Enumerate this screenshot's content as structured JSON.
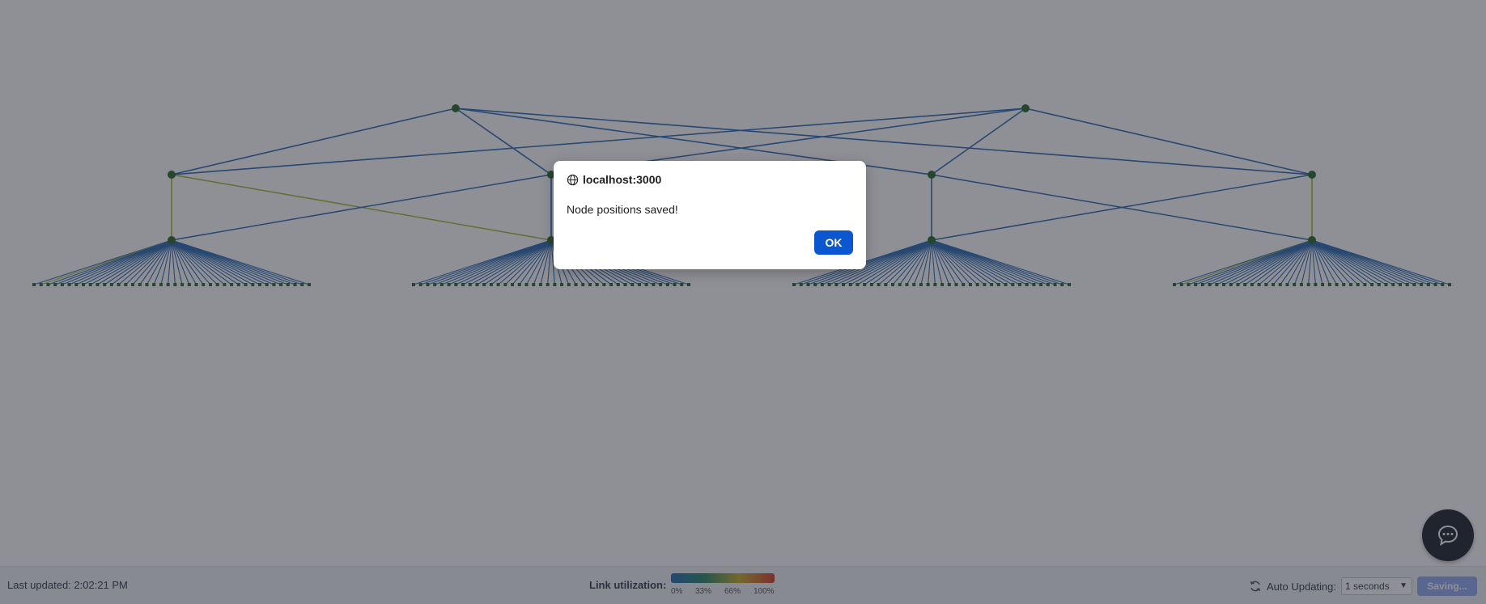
{
  "footer": {
    "last_updated": "Last updated: 2:02:21 PM",
    "legend": {
      "label": "Link utilization:",
      "ticks": [
        "0%",
        "33%",
        "66%",
        "100%"
      ],
      "colors": [
        "#2a6eb8",
        "#2e8a6a",
        "#c8b12f",
        "#d6402f"
      ]
    },
    "auto_updating_label": "Auto Updating:",
    "interval_selected": "1 seconds",
    "save_button": "Saving..."
  },
  "dialog": {
    "origin": "localhost:3000",
    "message": "Node positions saved!",
    "ok_label": "OK"
  },
  "icons": {
    "refresh": "refresh-icon",
    "globe": "globe-icon",
    "chat": "chat-icon"
  },
  "colors": {
    "link": "#2f6db3",
    "link_warm": "#a8b83a",
    "node": "#2e6b2e",
    "primary": "#0b57d0"
  }
}
